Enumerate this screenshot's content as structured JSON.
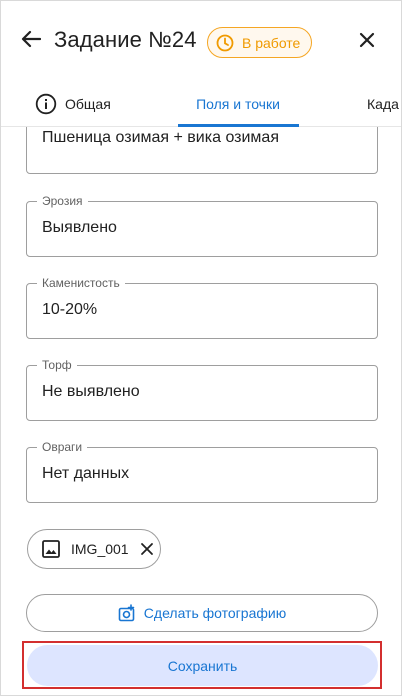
{
  "header": {
    "title": "Задание №24",
    "status": "В работе"
  },
  "tabs": [
    {
      "label": "Общая"
    },
    {
      "label": "Поля и точки"
    },
    {
      "label": "Када"
    }
  ],
  "fields": [
    {
      "label": "",
      "value": "Пшеница озимая + вика озимая"
    },
    {
      "label": "Эрозия",
      "value": "Выявлено"
    },
    {
      "label": "Каменистость",
      "value": "10-20%"
    },
    {
      "label": "Торф",
      "value": "Не выявлено"
    },
    {
      "label": "Овраги",
      "value": "Нет данных"
    }
  ],
  "attachment": {
    "name": "IMG_001"
  },
  "actions": {
    "take_photo": "Сделать фотографию",
    "save": "Сохранить"
  },
  "colors": {
    "accent": "#1976d2",
    "status": "#f5a623",
    "highlight": "#d32f2f",
    "save_bg": "#dde5ff"
  },
  "icons": [
    "back-arrow-icon",
    "clock-icon",
    "close-icon",
    "info-icon",
    "image-icon",
    "chip-close-icon",
    "add-photo-icon"
  ]
}
